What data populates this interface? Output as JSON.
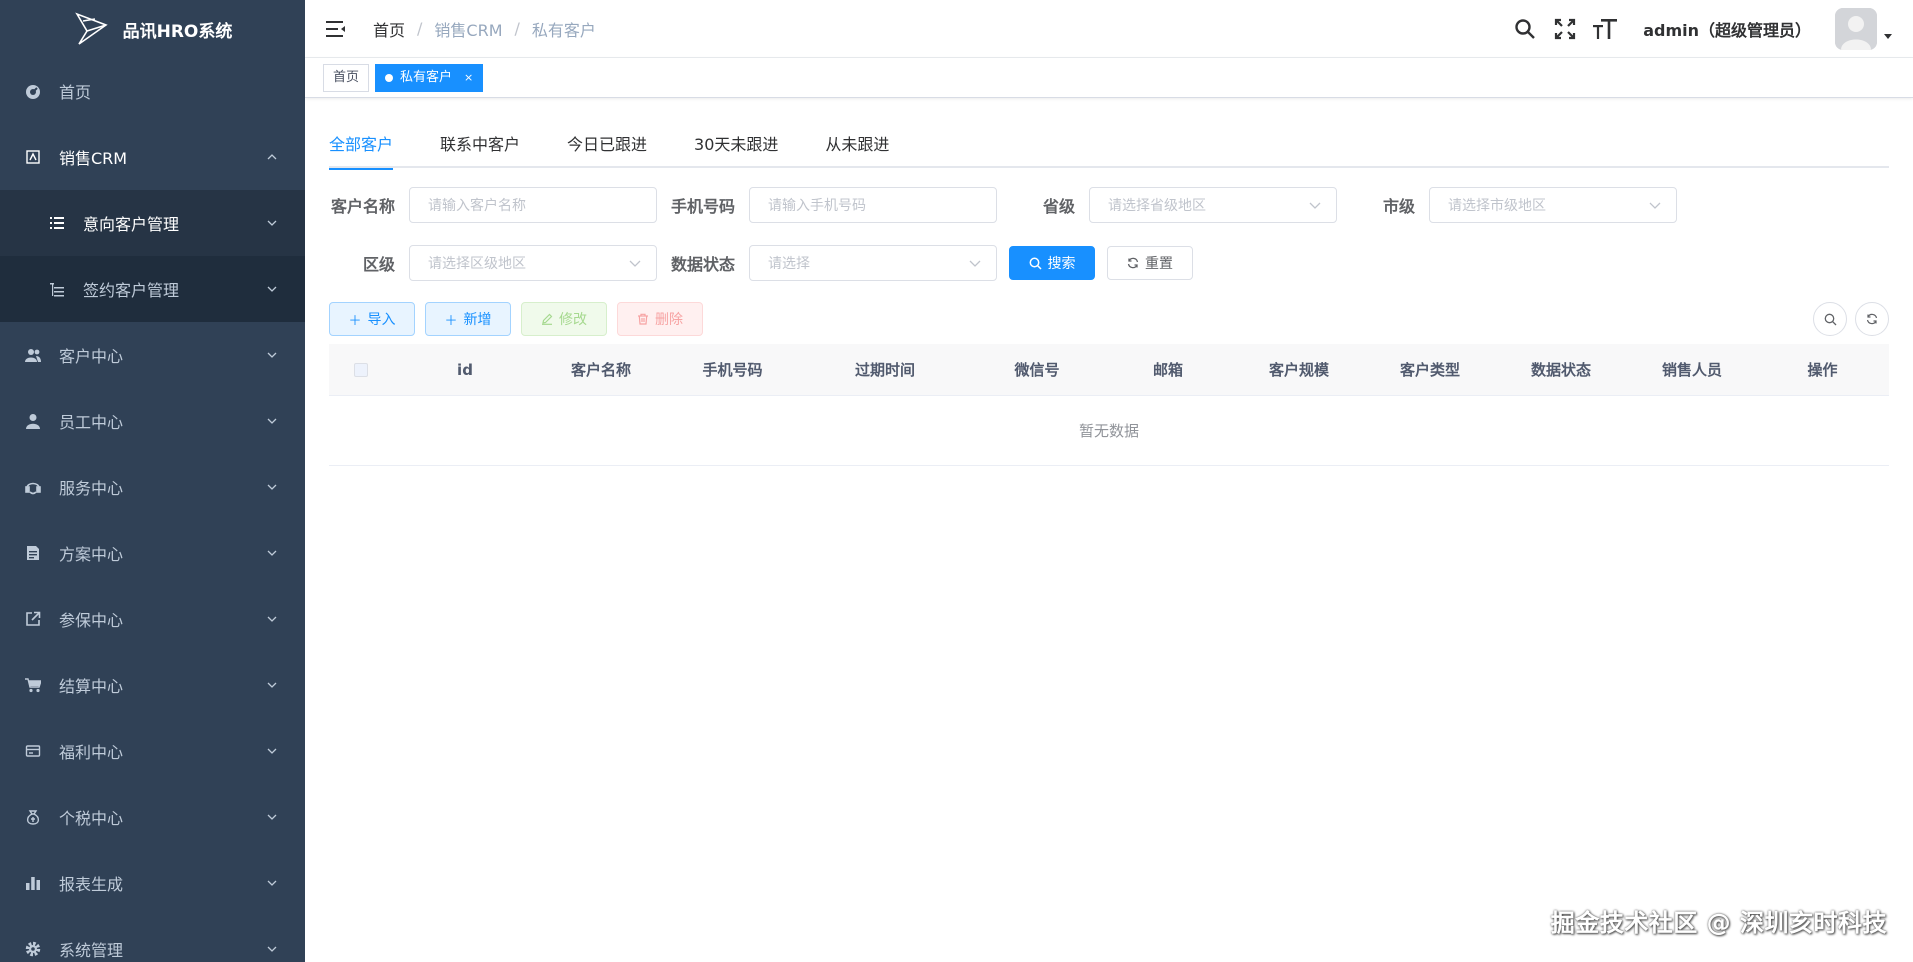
{
  "app": {
    "title": "品讯HRO系统"
  },
  "colors": {
    "sidebar_bg": "#304156",
    "submenu_bg": "#1f2d3d",
    "primary": "#1890ff"
  },
  "sidebar": {
    "items": [
      {
        "label": "首页",
        "icon": "dashboard-icon"
      },
      {
        "label": "销售CRM",
        "icon": "crm-icon",
        "expanded": true,
        "children": [
          {
            "label": "意向客户管理",
            "icon": "list-icon",
            "current": true
          },
          {
            "label": "签约客户管理",
            "icon": "tree-list-icon"
          }
        ]
      },
      {
        "label": "客户中心",
        "icon": "people-icon"
      },
      {
        "label": "员工中心",
        "icon": "user-icon"
      },
      {
        "label": "服务中心",
        "icon": "service-icon"
      },
      {
        "label": "方案中心",
        "icon": "document-icon"
      },
      {
        "label": "参保中心",
        "icon": "external-link-icon"
      },
      {
        "label": "结算中心",
        "icon": "cart-icon"
      },
      {
        "label": "福利中心",
        "icon": "card-icon"
      },
      {
        "label": "个税中心",
        "icon": "money-bag-icon"
      },
      {
        "label": "报表生成",
        "icon": "bar-chart-icon"
      },
      {
        "label": "系统管理",
        "icon": "gear-icon"
      }
    ]
  },
  "header": {
    "breadcrumb": [
      "首页",
      "销售CRM",
      "私有客户"
    ],
    "username": "admin（超级管理员）"
  },
  "tags": [
    {
      "label": "首页",
      "active": false
    },
    {
      "label": "私有客户",
      "active": true,
      "close": "×"
    }
  ],
  "tabs": [
    "全部客户",
    "联系中客户",
    "今日已跟进",
    "30天未跟进",
    "从未跟进"
  ],
  "filters": {
    "customer_name": {
      "label": "客户名称",
      "placeholder": "请输入客户名称"
    },
    "phone": {
      "label": "手机号码",
      "placeholder": "请输入手机号码"
    },
    "province": {
      "label": "省级",
      "placeholder": "请选择省级地区"
    },
    "city": {
      "label": "市级",
      "placeholder": "请选择市级地区"
    },
    "district": {
      "label": "区级",
      "placeholder": "请选择区级地区"
    },
    "data_status": {
      "label": "数据状态",
      "placeholder": "请选择"
    },
    "search_label": "搜索",
    "reset_label": "重置"
  },
  "toolbar": {
    "import_label": "导入",
    "add_label": "新增",
    "edit_label": "修改",
    "delete_label": "删除"
  },
  "table": {
    "columns": [
      "id",
      "客户名称",
      "手机号码",
      "过期时间",
      "微信号",
      "邮箱",
      "客户规模",
      "客户类型",
      "数据状态",
      "销售人员",
      "操作"
    ],
    "empty_text": "暂无数据"
  },
  "watermark": "掘金技术社区 @ 深圳亥时科技"
}
